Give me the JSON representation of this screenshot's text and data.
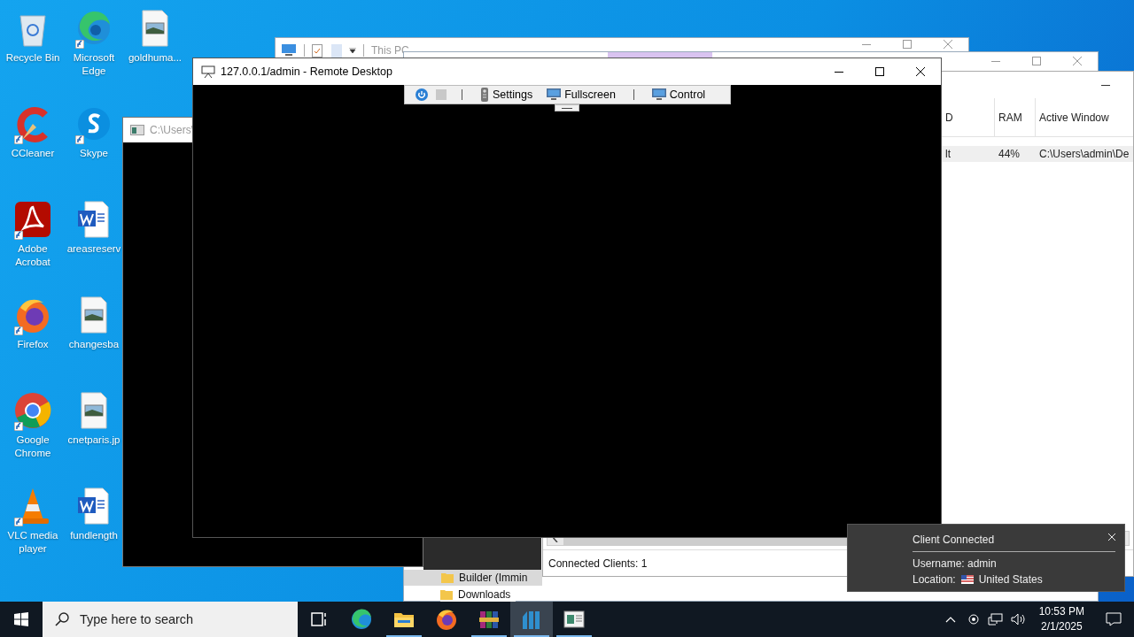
{
  "desktop_icons": [
    {
      "label": "Recycle Bin",
      "kind": "recycle",
      "shortcut": false
    },
    {
      "label": "Microsoft Edge",
      "kind": "edge",
      "shortcut": true
    },
    {
      "label": "goldhuma...",
      "kind": "image",
      "shortcut": false
    },
    {
      "label": "CCleaner",
      "kind": "ccleaner",
      "shortcut": true
    },
    {
      "label": "Skype",
      "kind": "skype",
      "shortcut": true
    },
    {
      "label": "Adobe Acrobat",
      "kind": "acrobat",
      "shortcut": true
    },
    {
      "label": "areasreserv",
      "kind": "word",
      "shortcut": false
    },
    {
      "label": "Firefox",
      "kind": "firefox",
      "shortcut": true
    },
    {
      "label": "changesba",
      "kind": "image",
      "shortcut": false
    },
    {
      "label": "Google Chrome",
      "kind": "chrome",
      "shortcut": true
    },
    {
      "label": "cnetparis.jp",
      "kind": "image",
      "shortcut": false
    },
    {
      "label": "VLC media player",
      "kind": "vlc",
      "shortcut": true
    },
    {
      "label": "fundlength",
      "kind": "word",
      "shortcut": false
    }
  ],
  "explorer_window": {
    "title": "This PC",
    "navigation": [
      {
        "label": "Builder (Immin",
        "selected": true
      },
      {
        "label": "Downloads",
        "selected": false
      }
    ]
  },
  "server_window": {
    "columns": [
      "D",
      "RAM",
      "Active Window"
    ],
    "rows": [
      {
        "cells": [
          "lt",
          "44%",
          "C:\\Users\\admin\\De"
        ],
        "selected": true
      }
    ],
    "status": "Connected Clients: 1"
  },
  "console_window": {
    "title": "C:\\Users\\"
  },
  "remote_desktop": {
    "title": "127.0.0.1/admin - Remote Desktop",
    "toolbar": [
      {
        "kind": "power"
      },
      {
        "kind": "stop"
      },
      {
        "kind": "separator"
      },
      {
        "kind": "remote",
        "label": "Settings"
      },
      {
        "kind": "monitor",
        "label": "Fullscreen"
      },
      {
        "kind": "separator"
      },
      {
        "kind": "monitor",
        "label": "Control"
      }
    ]
  },
  "notification": {
    "title": "Client Connected",
    "lines": [
      "Username: admin",
      "Location:"
    ],
    "country": "United States"
  },
  "taskbar": {
    "search_placeholder": "Type here to search",
    "apps": [
      {
        "kind": "taskview",
        "running": false,
        "selected": false
      },
      {
        "kind": "edge",
        "running": false,
        "selected": false
      },
      {
        "kind": "folder",
        "running": true,
        "selected": false
      },
      {
        "kind": "firefox",
        "running": false,
        "selected": false
      },
      {
        "kind": "winrar",
        "running": true,
        "selected": false
      },
      {
        "kind": "bars",
        "running": true,
        "selected": true
      },
      {
        "kind": "window",
        "running": true,
        "selected": false
      }
    ],
    "time": "10:53 PM",
    "date": "2/1/2025"
  }
}
